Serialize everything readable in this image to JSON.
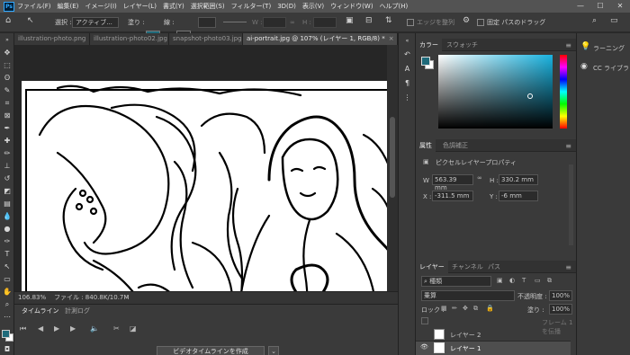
{
  "app": {
    "logo": "Ps"
  },
  "menu": {
    "items": [
      "ファイル(F)",
      "編集(E)",
      "イメージ(I)",
      "レイヤー(L)",
      "書式(Y)",
      "選択範囲(S)",
      "フィルター(T)",
      "3D(D)",
      "表示(V)",
      "ウィンドウ(W)",
      "ヘルプ(H)"
    ]
  },
  "window_controls": {
    "minimize": "—",
    "maximize": "☐",
    "close": "✕"
  },
  "options": {
    "select_label": "選択 :",
    "select_value": "アクティブ...",
    "fill_label": "塗り :",
    "stroke_label": "線 :",
    "w_label": "W :",
    "h_label": "H :",
    "align_edges": "エッジを整列",
    "fixed_path": "固定 パスのドラッグ"
  },
  "tabs": [
    {
      "label": "illustration-photo.png"
    },
    {
      "label": "illustration-photo02.jpg"
    },
    {
      "label": "snapshot-photo03.jpg"
    },
    {
      "label": "ai-portrait.jpg @ 107% (レイヤー 1, RGB/8) *",
      "active": true
    }
  ],
  "status": {
    "zoom": "106.83%",
    "file": "ファイル : 840.8K/10.7M"
  },
  "timeline": {
    "tab1": "タイムライン",
    "tab2": "計測ログ",
    "create_button": "ビデオタイムラインを作成"
  },
  "color_panel": {
    "tab1": "カラー",
    "tab2": "スウォッチ"
  },
  "properties": {
    "tab1": "属性",
    "tab2": "色調補正",
    "title": "ピクセルレイヤープロパティ",
    "w_label": "W :",
    "w": "563.39 mm",
    "h_label": "H :",
    "h": "330.2 mm",
    "x_label": "X :",
    "x": "-311.5 mm",
    "y_label": "Y :",
    "y": "-6 mm"
  },
  "layers": {
    "tab1": "レイヤー",
    "tab2": "チャンネル",
    "tab3": "パス",
    "filter_label": "種類",
    "blend_mode": "乗算",
    "opacity_label": "不透明度 :",
    "opacity": "100%",
    "lock_label": "ロック :",
    "fill_label": "塗り :",
    "fill": "100%",
    "frame_label": "フレーム 1 を伝播",
    "items": [
      {
        "name": "レイヤー 2"
      },
      {
        "name": "レイヤー 1"
      }
    ]
  },
  "learn_panel": {
    "learning": "ラーニング",
    "cc_libraries": "CC ライブラリ"
  },
  "colors": {
    "fg_swatch": "#1f6a7a",
    "stroke_swatch": "#e03030",
    "picker_hue": "#19b3e0"
  }
}
